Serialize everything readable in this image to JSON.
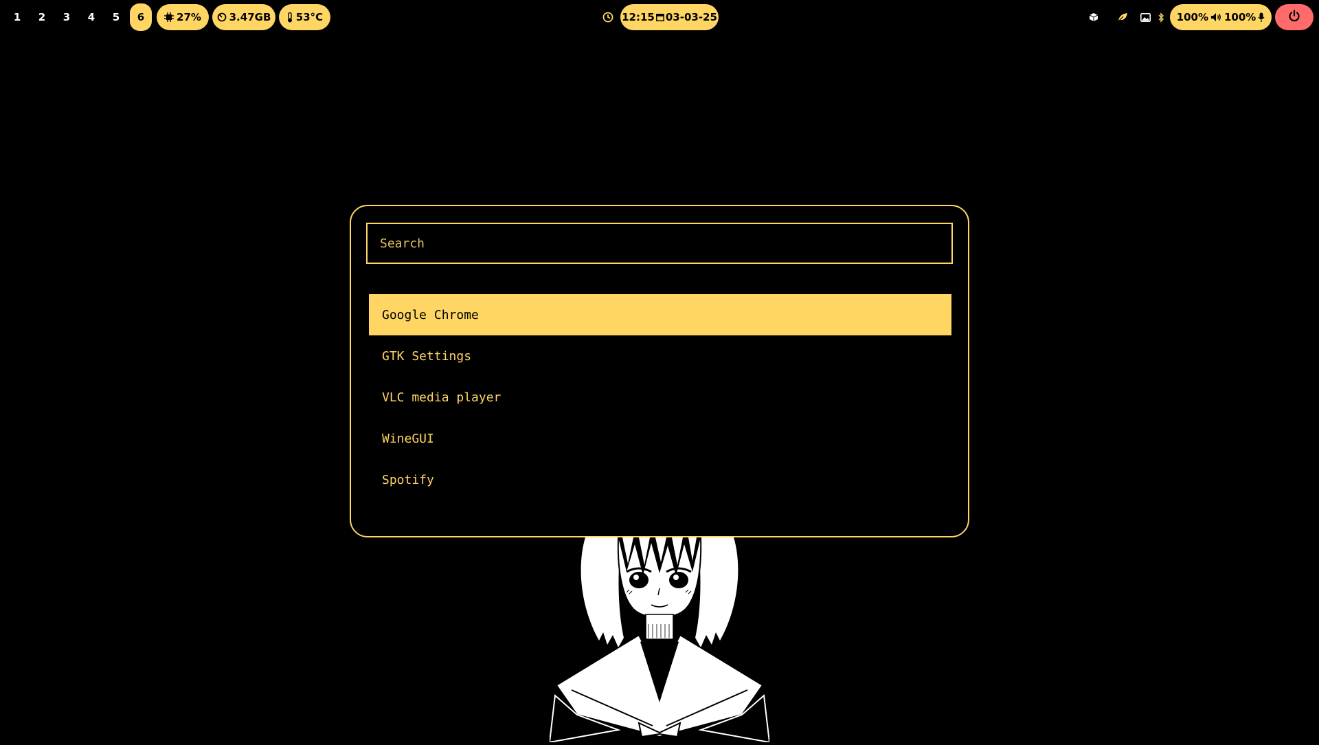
{
  "topbar": {
    "workspaces": [
      "1",
      "2",
      "3",
      "4",
      "5",
      "6"
    ],
    "active_workspace": "6",
    "cpu": "27%",
    "memory": "3.47GB",
    "temperature": "53°C",
    "clock": {
      "time": "12:15",
      "date": "03-03-25"
    },
    "brightness": "100%",
    "volume": "100%",
    "tray_icons": [
      "package-icon",
      "leaf-icon",
      "image-icon",
      "bluetooth-icon"
    ],
    "colors": {
      "accent": "#ffd664",
      "power": "#ff6b6b"
    }
  },
  "launcher": {
    "search_placeholder": "Search",
    "results": [
      {
        "label": "Google Chrome"
      },
      {
        "label": "GTK Settings"
      },
      {
        "label": "VLC media player"
      },
      {
        "label": "WineGUI"
      },
      {
        "label": "Spotify"
      }
    ],
    "selected_index": 0
  }
}
